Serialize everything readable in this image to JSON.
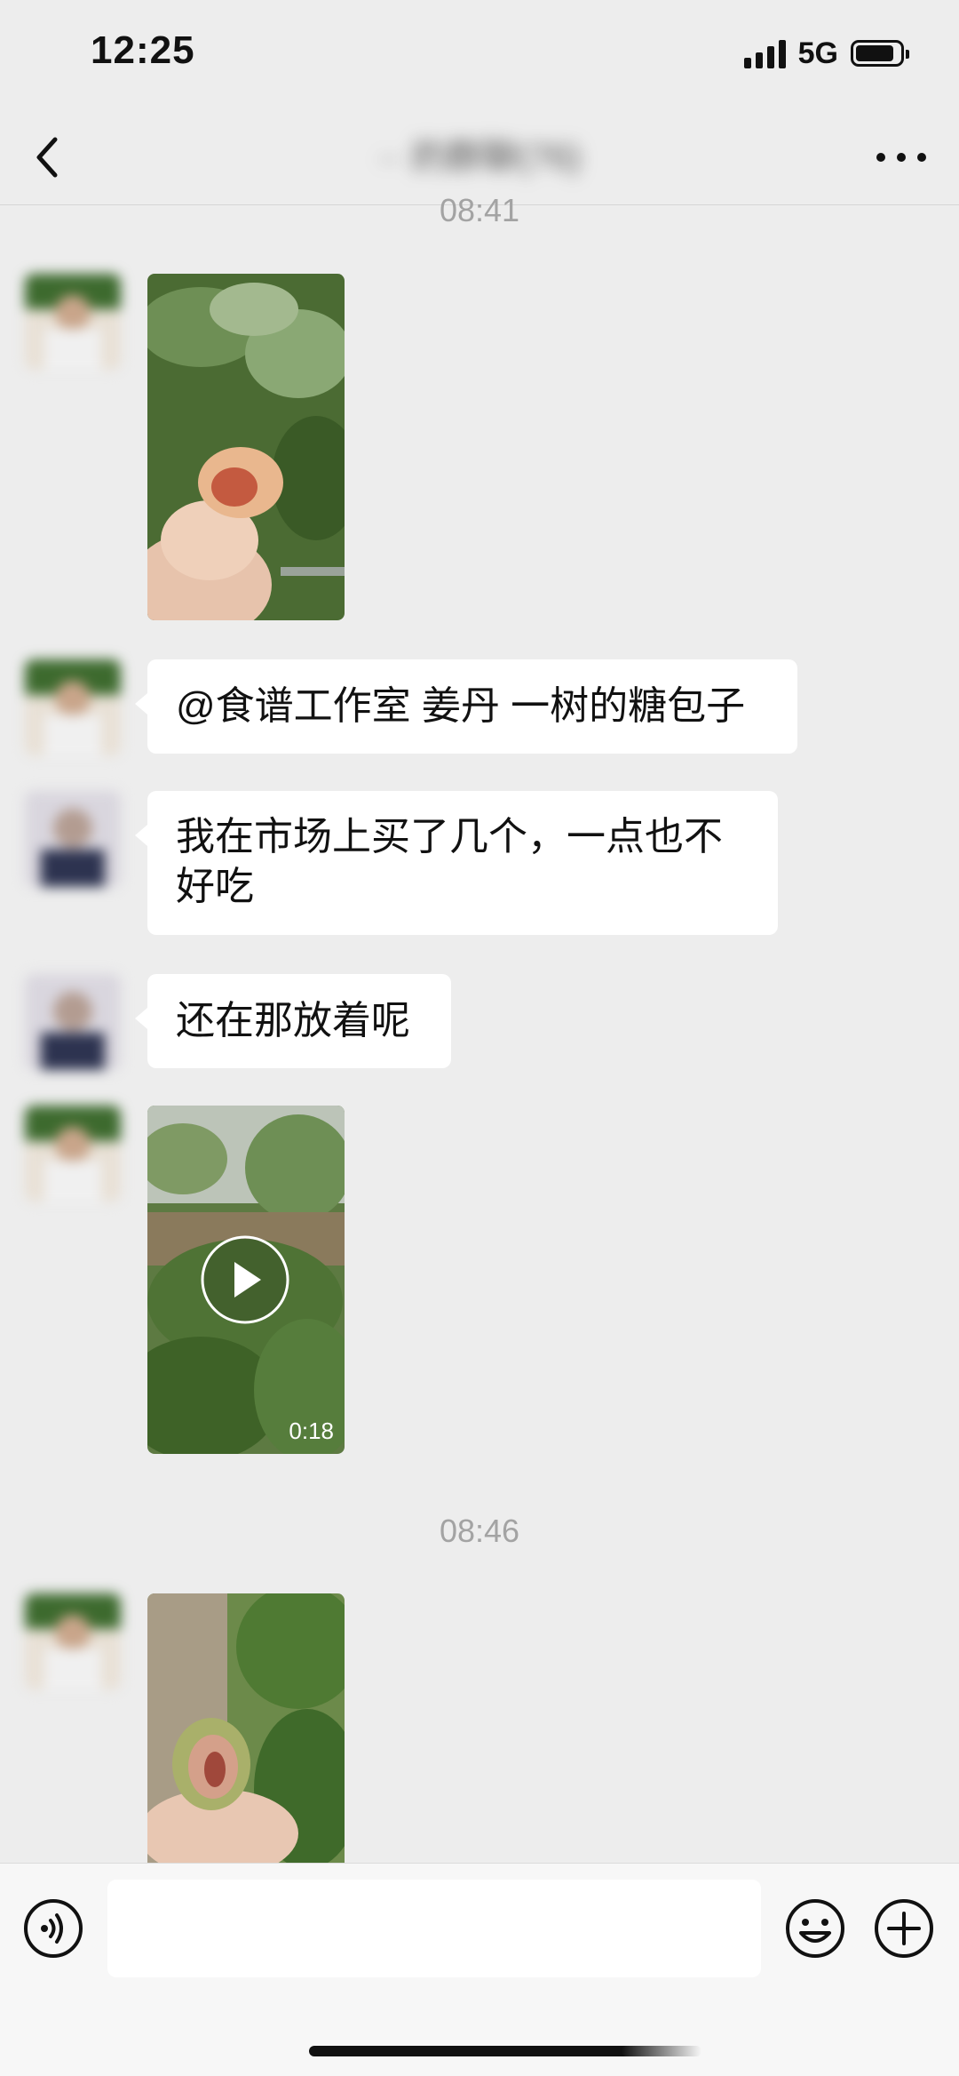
{
  "status_bar": {
    "time": "12:25",
    "network": "5G"
  },
  "nav": {
    "title": "·· 的群聊(76)",
    "back_icon": "chevron-left-icon",
    "more_icon": "more-dots-icon"
  },
  "chat": {
    "timestamps": [
      "08:41",
      "08:46"
    ],
    "messages": [
      {
        "type": "image",
        "avatar": "avatar-a"
      },
      {
        "type": "text",
        "avatar": "avatar-a",
        "text": "@食谱工作室 姜丹 一树的糖包子"
      },
      {
        "type": "text",
        "avatar": "avatar-b",
        "line1": "我在市场上买了几个，一点也不",
        "line2": "好吃"
      },
      {
        "type": "text",
        "avatar": "avatar-b",
        "text": "还在那放着呢"
      },
      {
        "type": "video",
        "avatar": "avatar-a",
        "duration": "0:18"
      },
      {
        "type": "image",
        "avatar": "avatar-a"
      }
    ]
  },
  "input_bar": {
    "voice_icon": "voice-icon",
    "emoji_icon": "emoji-icon",
    "plus_icon": "plus-icon",
    "placeholder": ""
  },
  "colors": {
    "background": "#ededed",
    "bubble": "#ffffff",
    "timestamp": "#a3a3a3"
  }
}
